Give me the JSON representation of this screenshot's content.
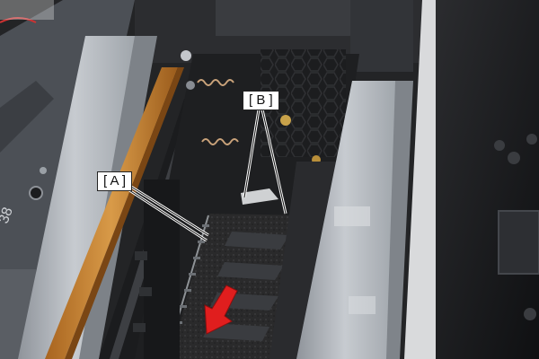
{
  "callouts": {
    "a": "[ A ]",
    "b": "[ B ]"
  },
  "arrow": {
    "color": "#e01e1e",
    "meaning": "arrow-down-left-icon"
  },
  "palette": {
    "chassis_dark": "#2a2b2d",
    "metal_light": "#b9bdc3",
    "ribbon_copper": "#c98a3a",
    "panel_black": "#111214"
  }
}
